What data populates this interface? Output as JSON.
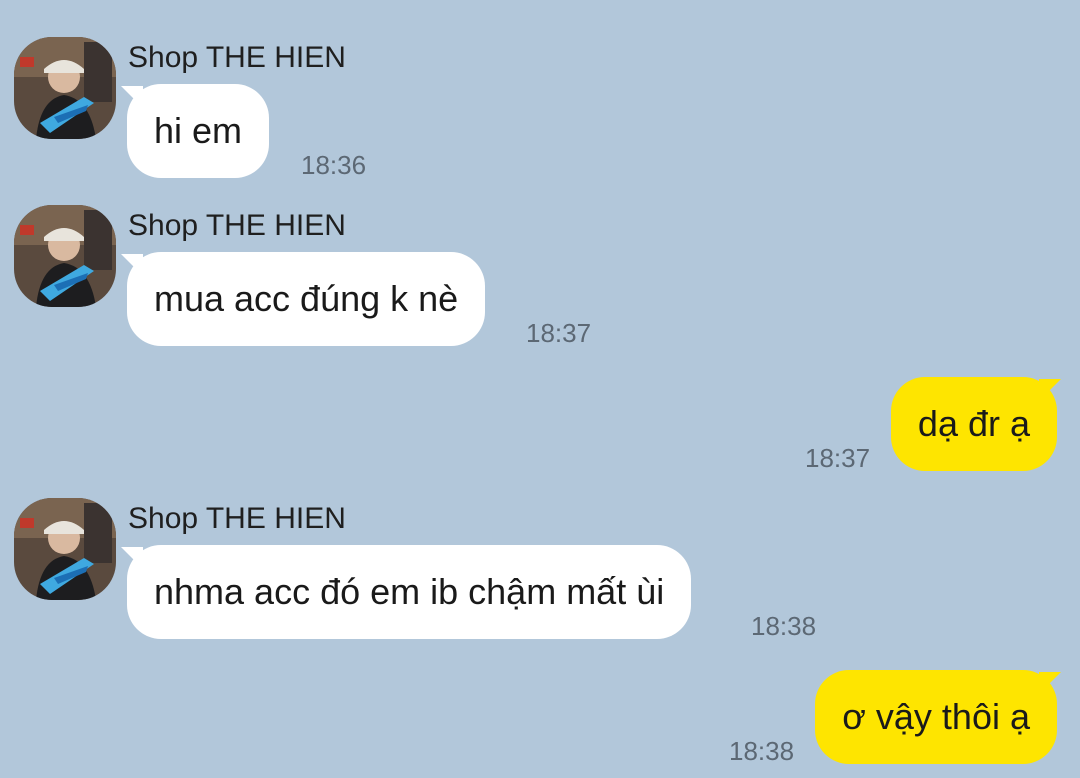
{
  "chat": {
    "messages": [
      {
        "direction": "in",
        "sender": "Shop THE HIEN",
        "text": "hi em",
        "time": "18:36",
        "avatar_icon": "user-avatar-icon"
      },
      {
        "direction": "in",
        "sender": "Shop THE HIEN",
        "text": "mua acc đúng k nè",
        "time": "18:37",
        "avatar_icon": "user-avatar-icon"
      },
      {
        "direction": "out",
        "text": "dạ đr ạ",
        "time": "18:37"
      },
      {
        "direction": "in",
        "sender": "Shop THE HIEN",
        "text": "nhma acc đó em ib chậm mất ùi",
        "time": "18:38",
        "avatar_icon": "user-avatar-icon"
      },
      {
        "direction": "out",
        "text": "ơ vậy thôi ạ",
        "time": "18:38"
      }
    ]
  },
  "theme": {
    "background": "#b2c7da",
    "incoming_bubble": "#ffffff",
    "outgoing_bubble": "#fee500",
    "time_color": "#5c6874"
  }
}
